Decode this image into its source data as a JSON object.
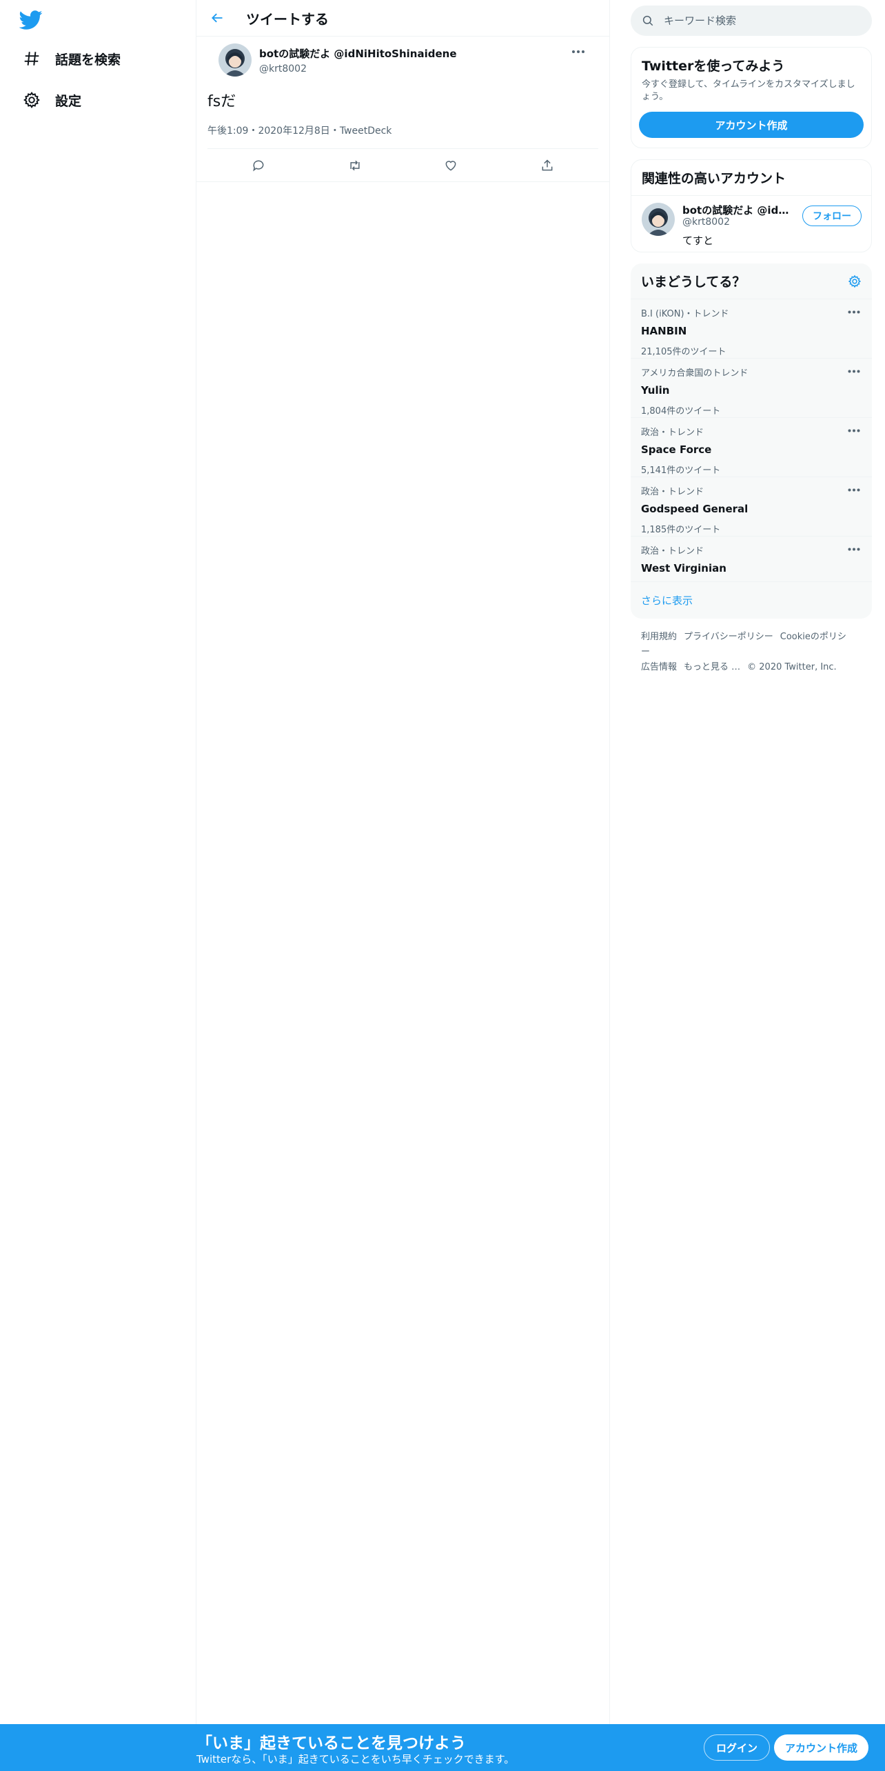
{
  "nav": {
    "items": [
      {
        "label": "話題を検索",
        "icon": "hashtag-icon"
      },
      {
        "label": "設定",
        "icon": "gear-icon"
      }
    ]
  },
  "header": {
    "title": "ツイートする"
  },
  "tweet": {
    "display_name": "botの試験だよ @idNiHitoShinaidene",
    "handle": "@krt8002",
    "text": "fsだ",
    "time": "午後1:09",
    "date": "2020年12月8日",
    "separator": "・",
    "source": "TweetDeck"
  },
  "search": {
    "placeholder": "キーワード検索"
  },
  "signup_card": {
    "title": "Twitterを使ってみよう",
    "description": "今すぐ登録して、タイムラインをカスタマイズしましょう。",
    "button": "アカウント作成"
  },
  "related": {
    "title": "関連性の高いアカウント",
    "user": {
      "name": "botの試験だよ @idNiHitoShinaidene",
      "handle": "@krt8002",
      "bio": "てすと",
      "follow": "フォロー"
    }
  },
  "trends": {
    "title": "いまどうしてる？",
    "items": [
      {
        "context": "B.I (iKON)・トレンド",
        "topic": "HANBIN",
        "count": "21,105件のツイート"
      },
      {
        "context": "アメリカ合衆国のトレンド",
        "topic": "Yulin",
        "count": "1,804件のツイート"
      },
      {
        "context": "政治・トレンド",
        "topic": "Space Force",
        "count": "5,141件のツイート"
      },
      {
        "context": "政治・トレンド",
        "topic": "Godspeed General",
        "count": "1,185件のツイート"
      },
      {
        "context": "政治・トレンド",
        "topic": "West Virginian",
        "count": ""
      }
    ],
    "show_more": "さらに表示"
  },
  "footer": {
    "links": [
      "利用規約",
      "プライバシーポリシー",
      "Cookieのポリシー",
      "広告情報",
      "もっと見る …"
    ],
    "copyright": "© 2020 Twitter, Inc."
  },
  "bottom_bar": {
    "title": "「いま」起きていることを見つけよう",
    "subtitle": "Twitterなら、「いま」起きていることをいち早くチェックできます。",
    "login": "ログイン",
    "signup": "アカウント作成"
  },
  "colors": {
    "accent": "#1d9bf0",
    "text": "#0f1419",
    "muted": "#536471",
    "border": "#eff3f4"
  }
}
